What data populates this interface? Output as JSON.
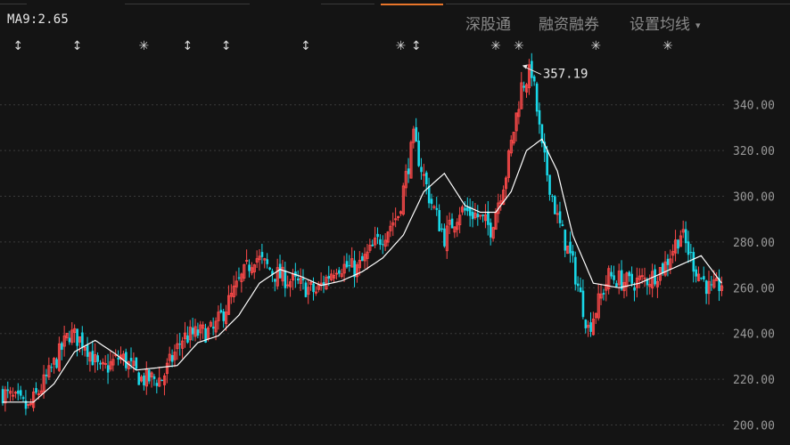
{
  "header": {
    "indicator": "MA9:2.65",
    "menu": [
      "深股通",
      "融资融券",
      "设置均线"
    ],
    "menu_caret": "▾"
  },
  "chart_data": {
    "type": "candlestick",
    "ylim": [
      195,
      375
    ],
    "yticks": [
      200,
      220,
      240,
      260,
      280,
      300,
      320,
      340
    ],
    "ytick_labels": [
      "200.00",
      "220.00",
      "240.00",
      "260.00",
      "280.00",
      "300.00",
      "320.00",
      "340.00"
    ],
    "grid": true,
    "peak_label": "357.19",
    "colors": {
      "up": "#ff4a4a",
      "down": "#18d8e8",
      "ma": "#ffffff",
      "grid": "#3a3a3a"
    },
    "ma_anchors": [
      [
        0,
        210
      ],
      [
        12,
        210
      ],
      [
        20,
        218
      ],
      [
        28,
        232
      ],
      [
        36,
        237
      ],
      [
        44,
        231
      ],
      [
        52,
        224
      ],
      [
        60,
        225
      ],
      [
        68,
        226
      ],
      [
        76,
        236
      ],
      [
        84,
        239
      ],
      [
        92,
        248
      ],
      [
        100,
        262
      ],
      [
        108,
        268
      ],
      [
        116,
        265
      ],
      [
        124,
        261
      ],
      [
        132,
        263
      ],
      [
        140,
        267
      ],
      [
        148,
        273
      ],
      [
        156,
        283
      ],
      [
        164,
        302
      ],
      [
        172,
        310
      ],
      [
        180,
        296
      ],
      [
        186,
        293
      ],
      [
        192,
        293
      ],
      [
        198,
        302
      ],
      [
        204,
        320
      ],
      [
        210,
        325
      ],
      [
        216,
        311
      ],
      [
        222,
        283
      ],
      [
        230,
        262
      ],
      [
        240,
        260
      ],
      [
        248,
        262
      ],
      [
        256,
        266
      ],
      [
        264,
        270
      ],
      [
        272,
        274
      ],
      [
        280,
        262
      ]
    ],
    "close_anchors": [
      [
        0,
        214
      ],
      [
        10,
        207
      ],
      [
        18,
        222
      ],
      [
        26,
        240
      ],
      [
        32,
        236
      ],
      [
        38,
        223
      ],
      [
        46,
        230
      ],
      [
        54,
        220
      ],
      [
        62,
        220
      ],
      [
        70,
        238
      ],
      [
        76,
        240
      ],
      [
        82,
        241
      ],
      [
        90,
        258
      ],
      [
        98,
        274
      ],
      [
        106,
        266
      ],
      [
        114,
        262
      ],
      [
        122,
        258
      ],
      [
        130,
        270
      ],
      [
        138,
        268
      ],
      [
        146,
        280
      ],
      [
        154,
        292
      ],
      [
        160,
        325
      ],
      [
        166,
        300
      ],
      [
        172,
        282
      ],
      [
        178,
        294
      ],
      [
        184,
        292
      ],
      [
        190,
        286
      ],
      [
        196,
        310
      ],
      [
        202,
        348
      ],
      [
        206,
        355
      ],
      [
        210,
        320
      ],
      [
        216,
        290
      ],
      [
        222,
        270
      ],
      [
        228,
        242
      ],
      [
        236,
        265
      ],
      [
        244,
        262
      ],
      [
        252,
        264
      ],
      [
        258,
        270
      ],
      [
        264,
        284
      ],
      [
        270,
        268
      ],
      [
        276,
        258
      ],
      [
        280,
        262
      ]
    ],
    "markers": [
      {
        "symbol": "↕",
        "index": 6
      },
      {
        "symbol": "↕",
        "index": 29
      },
      {
        "symbol": "✳",
        "index": 55
      },
      {
        "symbol": "↕",
        "index": 72
      },
      {
        "symbol": "↕",
        "index": 87
      },
      {
        "symbol": "↕",
        "index": 118
      },
      {
        "symbol": "✳",
        "index": 155
      },
      {
        "symbol": "↕",
        "index": 161
      },
      {
        "symbol": "✳",
        "index": 192
      },
      {
        "symbol": "✳",
        "index": 201
      },
      {
        "symbol": "✳",
        "index": 231
      },
      {
        "symbol": "✳",
        "index": 259
      }
    ]
  }
}
